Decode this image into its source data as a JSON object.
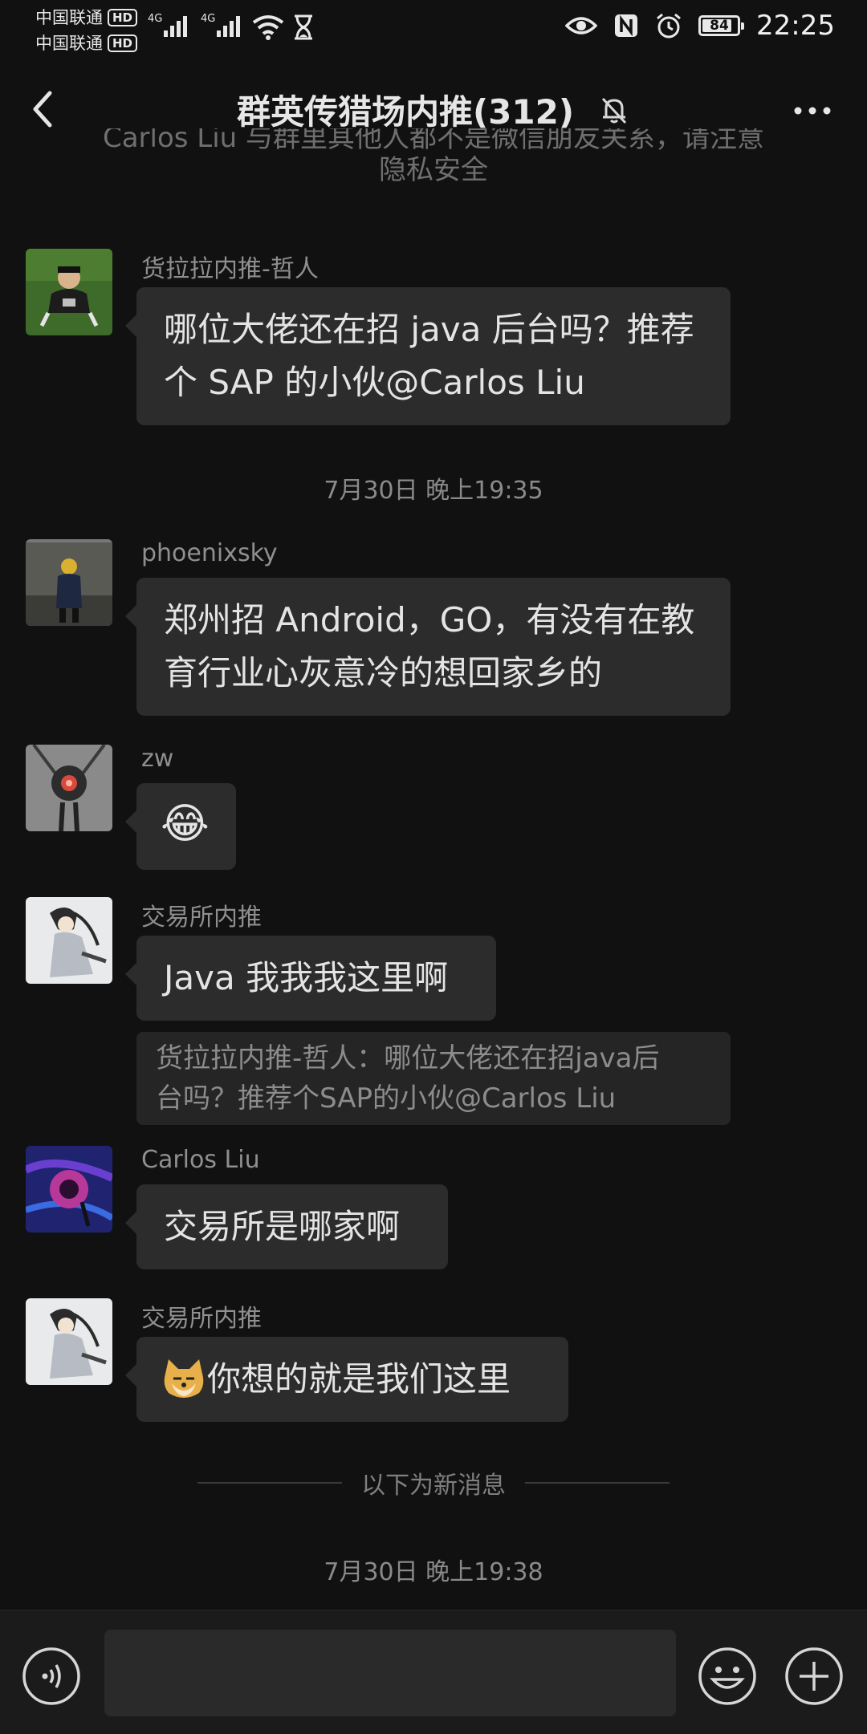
{
  "status_bar": {
    "carrier_1": "中国联通",
    "carrier_2": "中国联通",
    "hd_label": "HD",
    "network_1": "4G",
    "network_2": "4G",
    "battery": "84",
    "time": "22:25"
  },
  "header": {
    "title": "群英传猎场内推(312)"
  },
  "system_notice": {
    "line_1_partial": "Carlos Liu 与群里其他人都不是微信朋友关系，请注意",
    "line_2": "隐私安全"
  },
  "messages": [
    {
      "sender": "货拉拉内推-哲人",
      "text_lines": [
        "哪位大佬还在招 java 后台吗？推荐",
        "个 SAP 的小伙@Carlos Liu"
      ]
    },
    {
      "timestamp": "7月30日 晚上19:35"
    },
    {
      "sender": "phoenixsky",
      "text_lines": [
        "郑州招 Android，GO，有没有在教",
        "育行业心灰意冷的想回家乡的"
      ]
    },
    {
      "sender": "zw",
      "emoji": "😂"
    },
    {
      "sender": "交易所内推",
      "text": "Java 我我我这里啊",
      "quote_lines": [
        "货拉拉内推-哲人：哪位大佬还在招java后",
        "台吗？推荐个SAP的小伙@Carlos Liu"
      ]
    },
    {
      "sender": "Carlos Liu",
      "text": "交易所是哪家啊"
    },
    {
      "sender": "交易所内推",
      "emoji": "🐱",
      "text": "你想的就是我们这里"
    }
  ],
  "new_messages_divider": "以下为新消息",
  "last_timestamp": "7月30日 晚上19:38",
  "input": {
    "value": "",
    "placeholder": ""
  },
  "icons": {
    "back": "back-arrow-icon",
    "mute": "bell-off-icon",
    "more": "more-dots-icon",
    "voice": "voice-icon",
    "emoji": "emoji-icon",
    "plus": "plus-icon"
  }
}
